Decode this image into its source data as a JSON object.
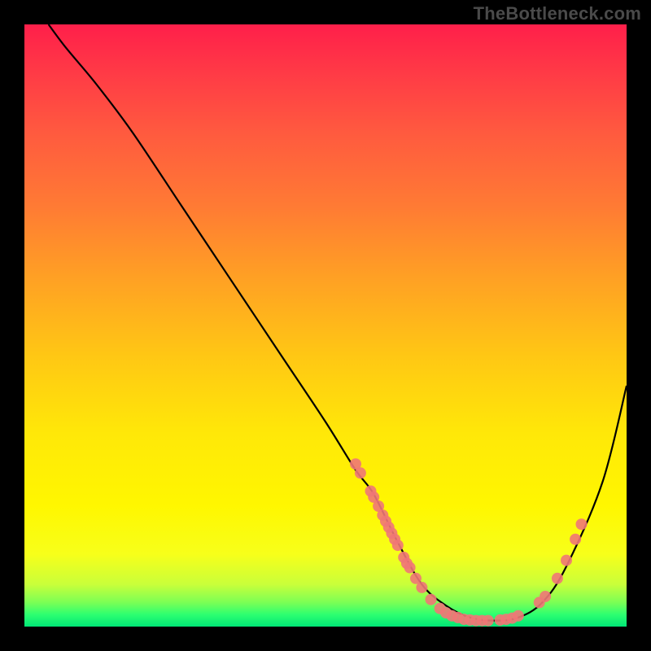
{
  "watermark": "TheBottleneck.com",
  "chart_data": {
    "type": "line",
    "title": "",
    "xlabel": "",
    "ylabel": "",
    "xlim": [
      0,
      100
    ],
    "ylim": [
      0,
      100
    ],
    "series": [
      {
        "name": "curve",
        "x": [
          4,
          7,
          12,
          18,
          26,
          34,
          42,
          50,
          55,
          58,
          62,
          66,
          70,
          74,
          78,
          82,
          86,
          90,
          96,
          100
        ],
        "y": [
          100,
          96,
          90,
          82,
          70,
          58,
          46,
          34,
          26,
          22,
          14,
          7,
          3.5,
          1.5,
          1.0,
          1.5,
          4,
          10,
          24,
          40
        ]
      }
    ],
    "markers": [
      {
        "x": 55.0,
        "y": 27.0
      },
      {
        "x": 55.8,
        "y": 25.5
      },
      {
        "x": 57.5,
        "y": 22.5
      },
      {
        "x": 58.0,
        "y": 21.5
      },
      {
        "x": 58.8,
        "y": 20.0
      },
      {
        "x": 59.5,
        "y": 18.5
      },
      {
        "x": 60.0,
        "y": 17.5
      },
      {
        "x": 60.5,
        "y": 16.5
      },
      {
        "x": 61.0,
        "y": 15.5
      },
      {
        "x": 61.5,
        "y": 14.5
      },
      {
        "x": 62.0,
        "y": 13.5
      },
      {
        "x": 63.0,
        "y": 11.5
      },
      {
        "x": 63.5,
        "y": 10.5
      },
      {
        "x": 64.0,
        "y": 9.8
      },
      {
        "x": 65.0,
        "y": 8.0
      },
      {
        "x": 66.0,
        "y": 6.5
      },
      {
        "x": 67.5,
        "y": 4.5
      },
      {
        "x": 69.0,
        "y": 3.0
      },
      {
        "x": 70.0,
        "y": 2.3
      },
      {
        "x": 71.0,
        "y": 1.8
      },
      {
        "x": 72.0,
        "y": 1.5
      },
      {
        "x": 73.0,
        "y": 1.2
      },
      {
        "x": 74.0,
        "y": 1.1
      },
      {
        "x": 75.0,
        "y": 1.0
      },
      {
        "x": 76.0,
        "y": 1.0
      },
      {
        "x": 77.0,
        "y": 1.0
      },
      {
        "x": 79.0,
        "y": 1.1
      },
      {
        "x": 80.0,
        "y": 1.2
      },
      {
        "x": 81.0,
        "y": 1.4
      },
      {
        "x": 82.0,
        "y": 1.8
      },
      {
        "x": 85.5,
        "y": 4.0
      },
      {
        "x": 86.5,
        "y": 5.0
      },
      {
        "x": 88.5,
        "y": 8.0
      },
      {
        "x": 90.0,
        "y": 11.0
      },
      {
        "x": 91.5,
        "y": 14.5
      },
      {
        "x": 92.5,
        "y": 17.0
      }
    ],
    "gradient_stops": [
      {
        "pos": 0.0,
        "color": "#ff1f4a"
      },
      {
        "pos": 0.8,
        "color": "#fff700"
      },
      {
        "pos": 1.0,
        "color": "#00e676"
      }
    ],
    "grid": false,
    "legend": false
  }
}
